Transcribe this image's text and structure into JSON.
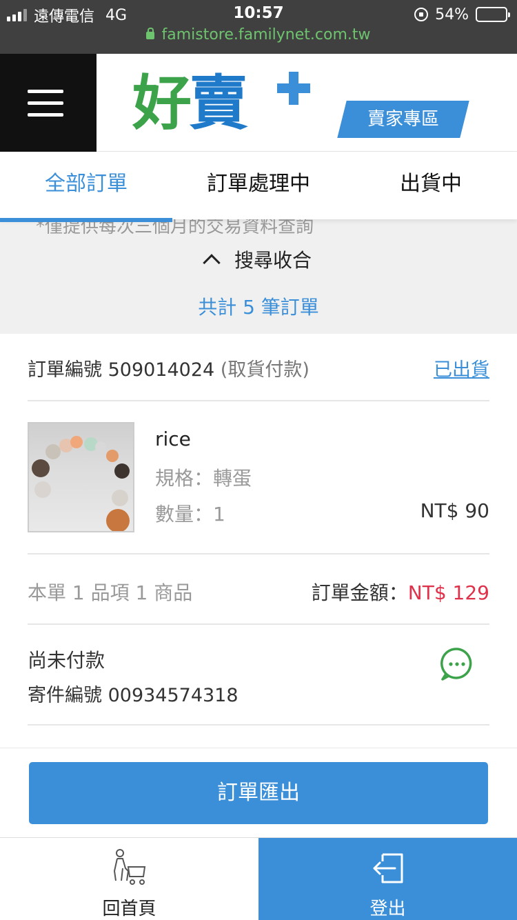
{
  "status_bar": {
    "carrier": "遠傳電信",
    "network": "4G",
    "time": "10:57",
    "battery": "54%",
    "battery_level": 0.54,
    "battery_color": "#f5c518"
  },
  "url": "famistore.familynet.com.tw",
  "header": {
    "menu_icon": "hamburger-menu-icon",
    "logo_text_1": "好",
    "logo_text_2": "賣",
    "seller_zone_label": "賣家專區"
  },
  "tabs": [
    {
      "label": "全部訂單",
      "active": true
    },
    {
      "label": "訂單處理中",
      "active": false
    },
    {
      "label": "出貨中",
      "active": false
    }
  ],
  "summary": {
    "note": "*僅提供每次三個月的交易資料查詢",
    "collapse_label": "搜尋收合",
    "total_text": "共計 5 筆訂單"
  },
  "order": {
    "number_label": "訂單編號 509014024",
    "payment_type": "(取貨付款)",
    "status_link": "已出貨",
    "product": {
      "name": "rice",
      "spec": "規格：轉蛋",
      "qty": "數量：1",
      "price": "NT$ 90"
    },
    "items_summary": "本單 1 品項 1 商品",
    "amount_label": "訂單金額：",
    "amount_value": "NT$ 129",
    "payment_status": "尚未付款",
    "tracking": "寄件編號 00934574318",
    "chat_icon": "chat-bubble-icon"
  },
  "export_label": "訂單匯出",
  "bottom_nav": {
    "home_label": "回首頁",
    "home_icon": "shopper-cart-icon",
    "logout_label": "登出",
    "logout_icon": "logout-icon"
  },
  "colors": {
    "accent": "#3a8fd8",
    "price_red": "#e0314b",
    "green": "#3ca34a",
    "status_bar": "#404040"
  }
}
